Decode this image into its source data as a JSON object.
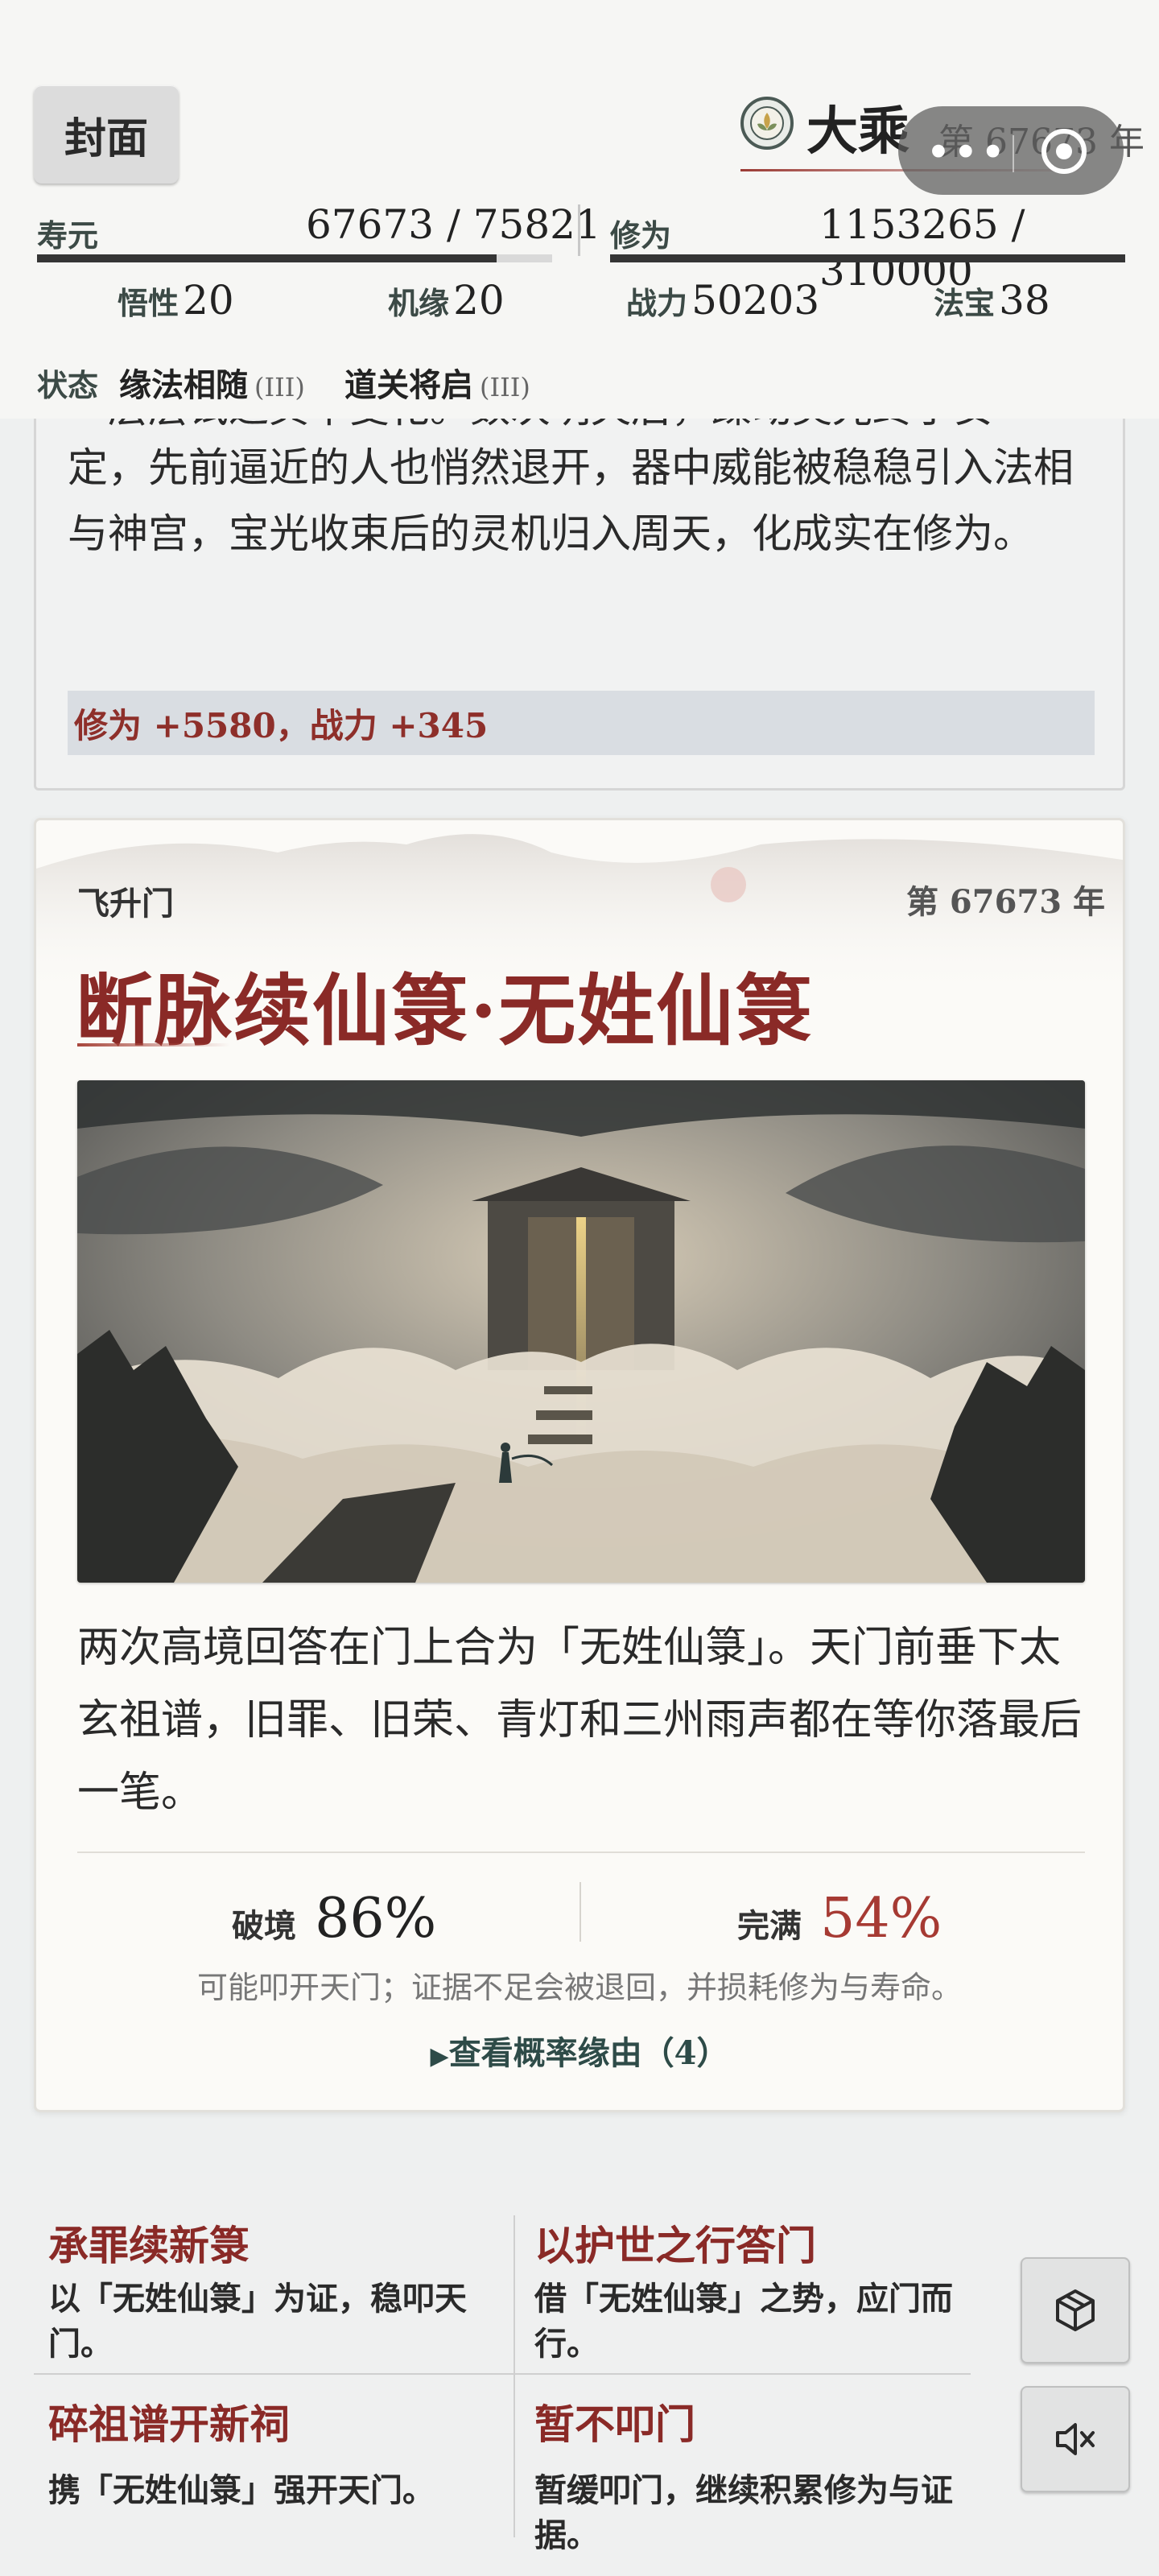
{
  "header": {
    "cover_button": "封面",
    "realm": "大乘",
    "year_label": "第 67673 年",
    "lifespan": {
      "label": "寿元",
      "value": "67673 / 75821",
      "progress": 0.8925
    },
    "cultivation": {
      "label": "修为",
      "value": "1153265 / 310000",
      "progress": 1.0
    },
    "attributes": [
      {
        "label": "悟性",
        "value": "20"
      },
      {
        "label": "机缘",
        "value": "20"
      },
      {
        "label": "战力",
        "value": "50203"
      },
      {
        "label": "法宝",
        "value": "38"
      }
    ],
    "status": {
      "label": "状态",
      "items": [
        {
          "name": "缘法相随",
          "level": "(III)"
        },
        {
          "name": "道关将启",
          "level": "(III)"
        }
      ]
    }
  },
  "log": {
    "text_partial_top": "一层层试过其中变化。数次明灭后，躁动灵光终于安",
    "text": "定，先前逼近的人也悄然退开，器中威能被稳稳引入法相与神宫，宝光收束后的灵机归入周天，化成实在修为。",
    "reward": "修为 +5580，战力 +345"
  },
  "event": {
    "sect": "飞升门",
    "year": "第 67673 年",
    "title": "断脉续仙箓·无姓仙箓",
    "description": "两次高境回答在门上合为「无姓仙箓」。天门前垂下太玄祖谱，旧罪、旧荣、青灯和三州雨声都在等你落最后一笔。",
    "breakthrough": {
      "label": "破境",
      "value": "86%"
    },
    "perfection": {
      "label": "完满",
      "value": "54%"
    },
    "note": "可能叩开天门；证据不足会被退回，并损耗修为与寿命。",
    "reasons_link": "查看概率缘由（4）"
  },
  "choices": [
    {
      "title": "承罪续新箓",
      "desc": "以「无姓仙箓」为证，稳叩天门。"
    },
    {
      "title": "以护世之行答门",
      "desc": "借「无姓仙箓」之势，应门而行。"
    },
    {
      "title": "碎祖谱开新祠",
      "desc": "携「无姓仙箓」强开天门。"
    },
    {
      "title": "暂不叩门",
      "desc": "暂缓叩门，继续积累修为与证据。"
    }
  ],
  "overlay": {
    "dots": "•••"
  },
  "icons": {
    "realm": "lotus-emblem-icon",
    "more": "more-dots-icon",
    "close": "target-circle-icon",
    "cube": "cube-icon",
    "mute": "speaker-muted-icon"
  },
  "colors": {
    "accent_red": "#8a2a27",
    "reward_red": "#8e2f2a",
    "link_teal": "#2e4b48"
  }
}
